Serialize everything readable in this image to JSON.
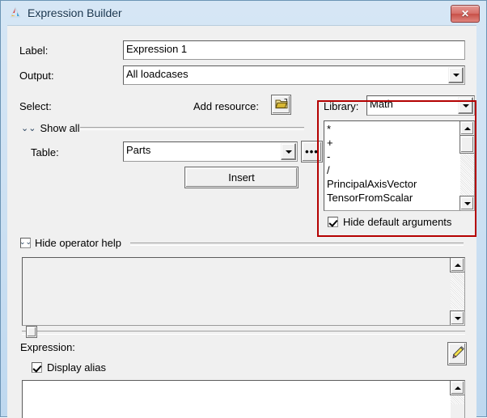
{
  "window": {
    "title": "Expression Builder",
    "app_icon": "triangle-logo-icon",
    "close_label": "✕"
  },
  "form": {
    "label_caption": "Label:",
    "label_value": "Expression 1",
    "output_caption": "Output:",
    "output_value": "All loadcases"
  },
  "select_section": {
    "caption": "Select:",
    "add_resource_caption": "Add resource:",
    "add_resource_icon": "open-folder-icon",
    "show_all_caption": "Show all",
    "show_all_icon": "double-chevron-down-icon",
    "table_caption": "Table:",
    "table_value": "Parts",
    "browse_label": "•••",
    "insert_label": "Insert"
  },
  "library_section": {
    "caption": "Library:",
    "value": "Math",
    "items": [
      "*",
      "+",
      "-",
      "/",
      "PrincipalAxisVector",
      "TensorFromScalar"
    ],
    "hide_default_arguments_label": "Hide default arguments",
    "hide_default_arguments_checked": true,
    "highlight_color": "#b40000"
  },
  "operator_help": {
    "caption": "Hide operator help",
    "toggle_icon": "double-chevron-down-icon",
    "content": ""
  },
  "expression_section": {
    "caption": "Expression:",
    "display_alias_label": "Display alias",
    "display_alias_checked": true,
    "edit_icon": "pencil-icon",
    "content": ""
  }
}
